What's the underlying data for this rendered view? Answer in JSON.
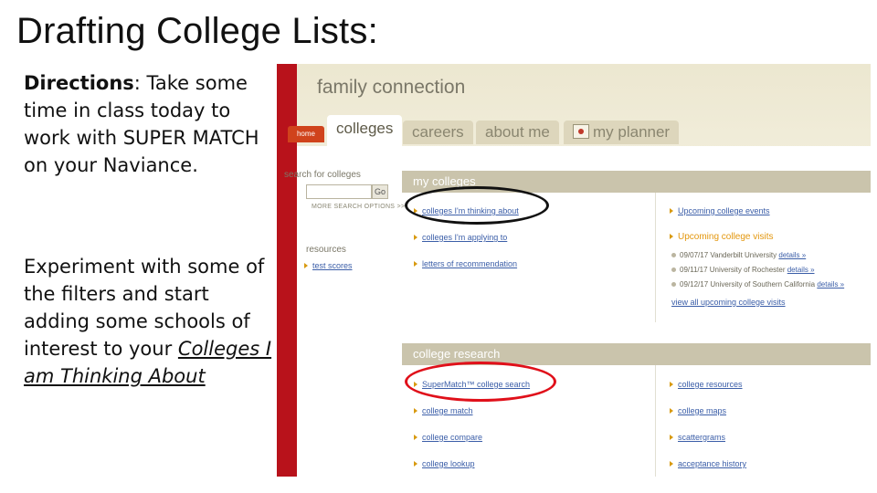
{
  "slide": {
    "title": "Drafting College Lists:",
    "directions_label": "Directions",
    "directions_text": ": Take some time in class today to work with SUPER MATCH on your Naviance.",
    "experiment_text": "Experiment with some of the filters and start adding some schools of interest to your ",
    "experiment_link": "Colleges I am Thinking About"
  },
  "app": {
    "brand": "family connection",
    "home_tab": "home",
    "tabs": [
      {
        "label": "colleges",
        "active": true
      },
      {
        "label": "careers",
        "active": false
      },
      {
        "label": "about me",
        "active": false
      },
      {
        "label": "my planner",
        "active": false
      }
    ],
    "sidebar": {
      "search_title": "search for colleges",
      "go_label": "Go",
      "more_options": "MORE SEARCH OPTIONS >>",
      "resources_title": "resources",
      "resources_link": "test scores"
    },
    "my_colleges": {
      "header": "my colleges",
      "left": [
        "colleges I'm thinking about",
        "colleges I'm applying to",
        "letters of recommendation"
      ],
      "right_events": "Upcoming college events",
      "right_visits_title": "Upcoming college visits",
      "visits": [
        {
          "date": "09/07/17",
          "school": "Vanderbilt University",
          "details": "details »"
        },
        {
          "date": "09/11/17",
          "school": "University of Rochester",
          "details": "details »"
        },
        {
          "date": "09/12/17",
          "school": "University of Southern California",
          "details": "details »"
        }
      ],
      "view_all": "view all upcoming college visits"
    },
    "college_research": {
      "header": "college research",
      "left": [
        "SuperMatch™ college search",
        "college match",
        "college compare",
        "college lookup"
      ],
      "right": [
        "college resources",
        "college maps",
        "scattergrams",
        "acceptance history"
      ]
    },
    "highlights": {
      "black_oval_color": "#111111",
      "red_oval_color": "#e0101a"
    }
  }
}
